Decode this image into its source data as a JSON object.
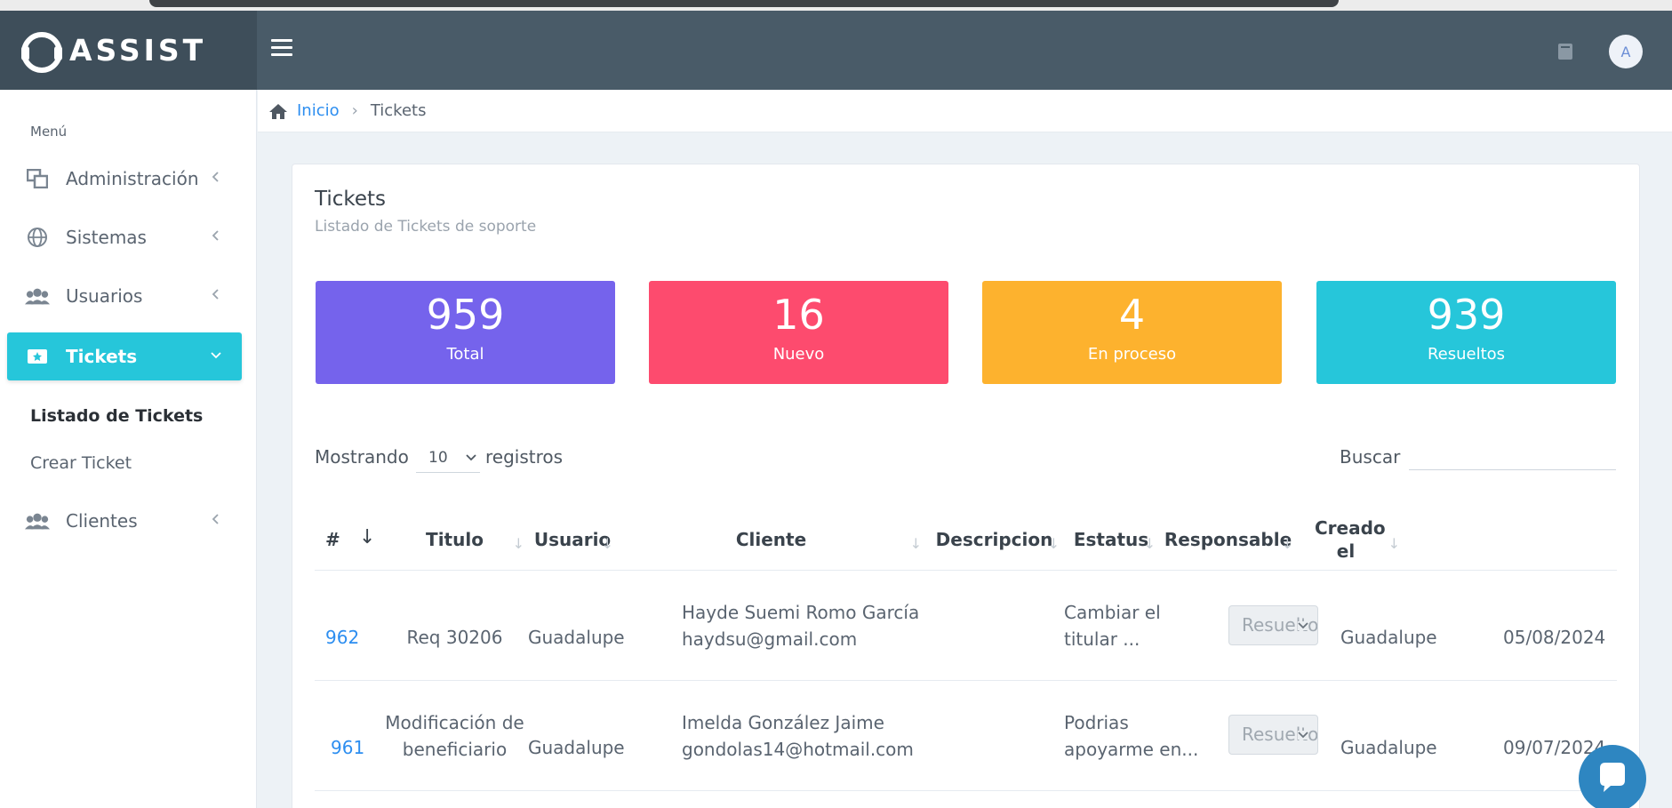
{
  "brand": {
    "name": "ASSIST"
  },
  "header": {
    "avatar_initial": "A"
  },
  "sidebar": {
    "menu_title": "Menú",
    "items": [
      {
        "label": "Administración",
        "icon": "windows-icon"
      },
      {
        "label": "Sistemas",
        "icon": "globe-icon"
      },
      {
        "label": "Usuarios",
        "icon": "users-icon"
      },
      {
        "label": "Tickets",
        "icon": "ticket-icon",
        "active": true
      },
      {
        "label": "Clientes",
        "icon": "users-icon"
      }
    ],
    "subitems": [
      {
        "label": "Listado de Tickets",
        "active": true
      },
      {
        "label": "Crear Ticket"
      }
    ]
  },
  "breadcrumb": {
    "home": "Inicio",
    "current": "Tickets"
  },
  "card": {
    "title": "Tickets",
    "subtitle": "Listado de Tickets de soporte"
  },
  "stats": [
    {
      "value": "959",
      "label": "Total",
      "color": "#7563ec"
    },
    {
      "value": "16",
      "label": "Nuevo",
      "color": "#fd4b6e"
    },
    {
      "value": "4",
      "label": "En proceso",
      "color": "#fdb22e"
    },
    {
      "value": "939",
      "label": "Resueltos",
      "color": "#26c6da"
    }
  ],
  "table_controls": {
    "show_label": "Mostrando",
    "page_length": "10",
    "records_label": "registros",
    "search_label": "Buscar",
    "search_value": ""
  },
  "table": {
    "headers": [
      "#",
      "Titulo",
      "Usuario",
      "Cliente",
      "Descripcion",
      "Estatus",
      "Responsable",
      "Creado el"
    ],
    "rows": [
      {
        "id": "962",
        "titulo": "Req 30206",
        "usuario": "Guadalupe",
        "cliente_nombre": "Hayde Suemi Romo García",
        "cliente_email": "haydsu@gmail.com",
        "descripcion": "Cambiar el titular ...",
        "estatus": "Resuelto",
        "responsable": "Guadalupe",
        "creado": "05/08/2024"
      },
      {
        "id": "961",
        "titulo": "Modificación de beneficiario",
        "usuario": "Guadalupe",
        "cliente_nombre": "Imelda González Jaime",
        "cliente_email": "gondolas14@hotmail.com",
        "descripcion": "Podrias apoyarme en...",
        "estatus": "Resuelto",
        "responsable": "Guadalupe",
        "creado": "09/07/2024"
      }
    ]
  },
  "colors": {
    "topbar": "#495b68",
    "accent": "#26c6da",
    "link": "#2d8ef0",
    "chat": "#2e86c1"
  }
}
